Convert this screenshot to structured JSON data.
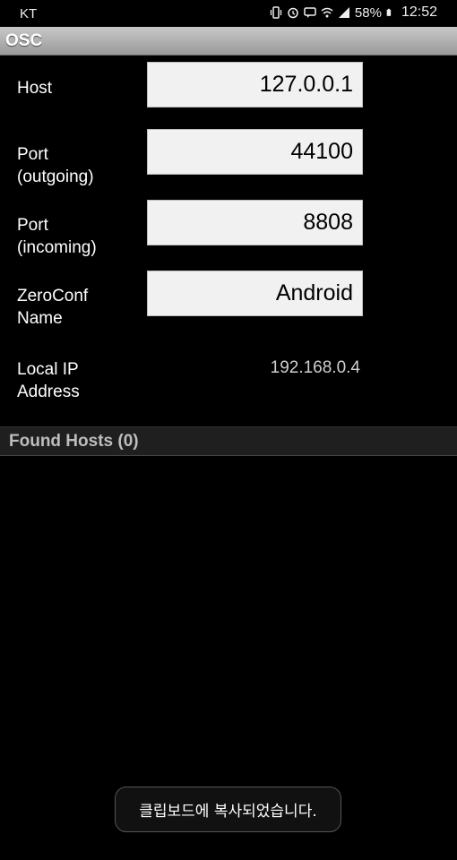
{
  "status_bar": {
    "carrier": "KT",
    "battery": "58%",
    "time": "12:52",
    "icons": [
      "vibrate-icon",
      "alarm-icon",
      "messenger-icon",
      "wifi-icon",
      "signal-icon",
      "battery-icon"
    ]
  },
  "header": {
    "title": "OSC"
  },
  "form": {
    "host_label": "Host",
    "host_value": "127.0.0.1",
    "port_out_label_1": "Port",
    "port_out_label_2": "(outgoing)",
    "port_out_value": "44100",
    "port_in_label_1": "Port",
    "port_in_label_2": "(incoming)",
    "port_in_value": "8808",
    "zeroconf_label_1": "ZeroConf",
    "zeroconf_label_2": "Name",
    "zeroconf_value": "Android",
    "local_ip_label_1": "Local IP",
    "local_ip_label_2": "Address",
    "local_ip_value": "192.168.0.4"
  },
  "found_hosts": {
    "title": "Found Hosts (0)"
  },
  "toast": {
    "message": "클립보드에 복사되었습니다."
  },
  "colors": {
    "header_bg": "#b0b0b0",
    "field_bg": "#f1f1f1",
    "background": "#000000"
  }
}
